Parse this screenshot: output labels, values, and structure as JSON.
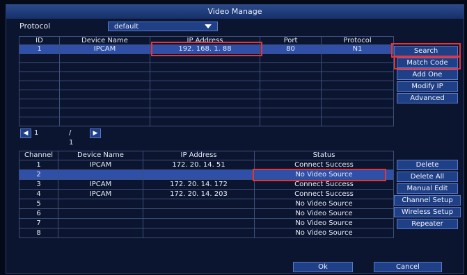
{
  "window": {
    "title": "Video Manage"
  },
  "protocol": {
    "label": "Protocol",
    "value": "default"
  },
  "device_table": {
    "headers": [
      "ID",
      "Device Name",
      "IP Address",
      "Port",
      "Protocol"
    ],
    "rows": [
      [
        "1",
        "IPCAM",
        "192. 168. 1. 88",
        "80",
        "N1"
      ]
    ]
  },
  "side_buttons": [
    "Search",
    "Match Code",
    "Add One",
    "Modify IP",
    "Advanced"
  ],
  "pager": {
    "current": "1",
    "total": "/ 1"
  },
  "channel_table": {
    "headers": [
      "Channel",
      "Device Name",
      "IP Address",
      "Status"
    ],
    "rows": [
      [
        "1",
        "IPCAM",
        "172. 20. 14. 51",
        "Connect Success"
      ],
      [
        "2",
        "",
        "",
        "No Video Source"
      ],
      [
        "3",
        "IPCAM",
        "172. 20. 14. 172",
        "Connect Success"
      ],
      [
        "4",
        "IPCAM",
        "172. 20. 14. 203",
        "Connect Success"
      ],
      [
        "5",
        "",
        "",
        "No Video Source"
      ],
      [
        "6",
        "",
        "",
        "No Video Source"
      ],
      [
        "7",
        "",
        "",
        "No Video Source"
      ],
      [
        "8",
        "",
        "",
        "No Video Source"
      ]
    ]
  },
  "channel_buttons": [
    "Delete",
    "Delete All",
    "Manual Edit",
    "Channel Setup",
    "Wireless Setup",
    "Repeater"
  ],
  "footer": {
    "ok": "Ok",
    "cancel": "Cancel"
  },
  "colors": {
    "background": "#0b1530",
    "selected_row": "#2f4fa8",
    "button": "#1f3f86",
    "highlight": "#e8333d"
  },
  "icons": [
    "dropdown-arrow-icon",
    "page-prev-icon",
    "page-next-icon"
  ]
}
